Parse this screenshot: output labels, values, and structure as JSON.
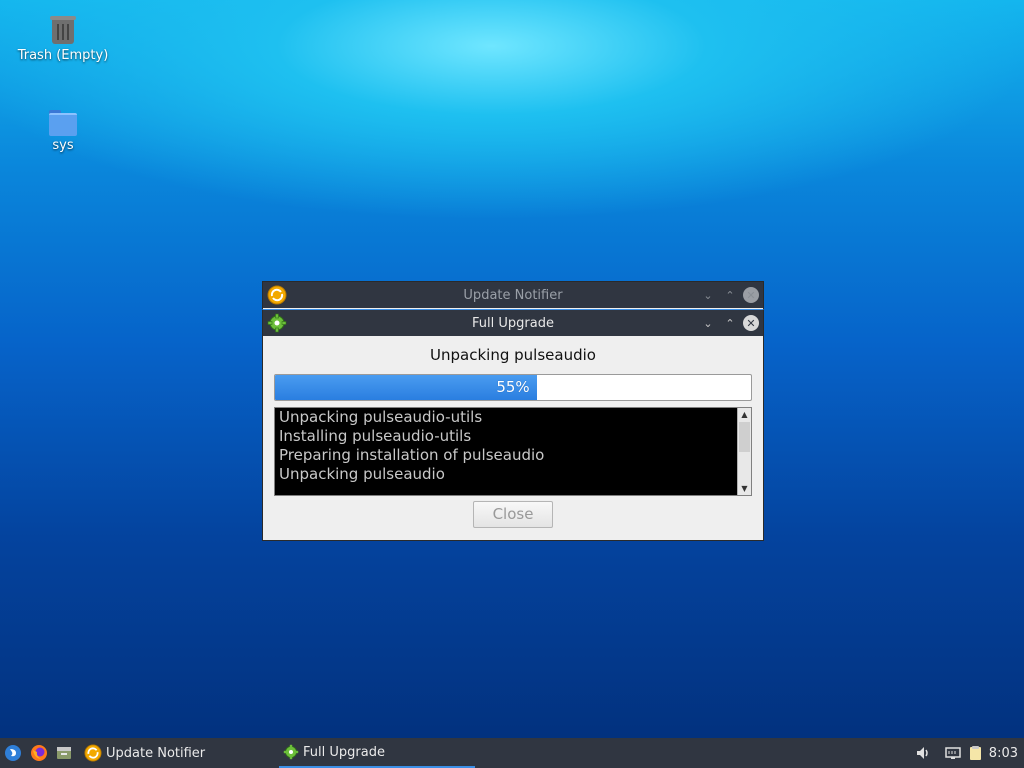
{
  "desktop": {
    "icons": [
      {
        "label": "Trash (Empty)",
        "icon": "trash-icon"
      },
      {
        "label": "sys",
        "icon": "folder-icon"
      }
    ]
  },
  "update_notifier_window": {
    "title": "Update Notifier",
    "icon": "update-notifier-icon"
  },
  "full_upgrade_window": {
    "title": "Full Upgrade",
    "icon": "gear-icon",
    "status_text": "Unpacking pulseaudio",
    "progress": {
      "percent": 55,
      "label": "55%"
    },
    "log_lines": [
      "Unpacking pulseaudio-utils",
      "Installing pulseaudio-utils",
      "Preparing installation of pulseaudio",
      "Unpacking pulseaudio"
    ],
    "close_button": "Close"
  },
  "taskbar": {
    "launchers": [
      "start-menu-icon",
      "firefox-icon",
      "file-manager-icon"
    ],
    "tasks": [
      {
        "label": "Update Notifier",
        "icon": "update-notifier-icon",
        "active": false
      },
      {
        "label": "Full Upgrade",
        "icon": "gear-icon",
        "active": true
      }
    ],
    "tray": [
      "volume-icon",
      "network-icon",
      "clipboard-icon"
    ],
    "clock": "8:03"
  },
  "colors": {
    "titlebar": "#303641",
    "progress_fill": "#2a7ee0",
    "taskbar": "#303641"
  }
}
